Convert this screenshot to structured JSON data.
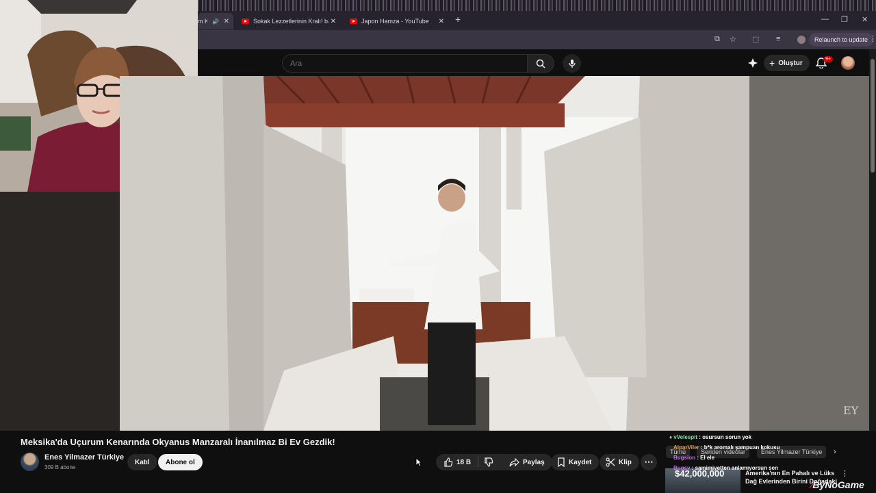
{
  "browser": {
    "tabs": [
      {
        "title": "m K",
        "active": true
      },
      {
        "title": "Sokak Lezzetlerinin Kralı! bahar",
        "active": false
      },
      {
        "title": "Japon Hamza - YouTube",
        "active": false
      }
    ],
    "relaunch_label": "Relaunch to update"
  },
  "youtube": {
    "search_placeholder": "Ara",
    "create_label": "Oluştur",
    "notification_count": "9+"
  },
  "video": {
    "title": "Meksika'da Uçurum Kenarında Okyanus Manzaralı İnanılmaz Bi Ev Gezdik!",
    "watermark": "EY",
    "channel_name": "Enes Yilmazer Türkiye",
    "subscribers": "309 B abone",
    "join_label": "Katıl",
    "subscribe_label": "Abone ol",
    "like_count": "18 B",
    "share_label": "Paylaş",
    "save_label": "Kaydet",
    "clip_label": "Klip"
  },
  "chat": {
    "messages": [
      {
        "user": "vVelespit",
        "text": "osursun sorun yok",
        "color": "#7fe0a0"
      },
      {
        "user": "AlparViler",
        "text": "b*k aromalı şampuan kokusu",
        "color": "#e0a050"
      },
      {
        "user": "Bugsion",
        "text": "El ele",
        "color": "#c070e0"
      },
      {
        "user": "Bugsy",
        "text": "samimiyetten anlamıyorsun sen",
        "color": "#c070e0"
      }
    ]
  },
  "recommendation_chips": [
    "Tümü",
    "Seriden videolar",
    "Enes Yilmazer Türkiye"
  ],
  "recommendation": {
    "price": "$42,000,000",
    "title_line1": "Amerika'nın En Pahalı ve Lüks",
    "title_line2": "Dağ Evlerinden Birini Doğadaki"
  },
  "overlay_watermark": "ByNoGame"
}
